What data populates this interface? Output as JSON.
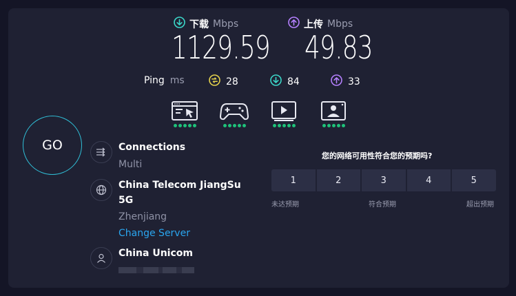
{
  "download": {
    "label": "下载",
    "unit": "Mbps",
    "value": "1129.59",
    "color": "#3bd7c9"
  },
  "upload": {
    "label": "上传",
    "unit": "Mbps",
    "value": "49.83",
    "color": "#b580ff"
  },
  "ping": {
    "label": "Ping",
    "unit": "ms",
    "idle": "28",
    "download": "84",
    "upload": "33",
    "idle_color": "#e6d34c"
  },
  "experience": {
    "dot_color": "#1ec27a",
    "items": [
      {
        "name": "web-browsing",
        "rating": 5,
        "max": 5
      },
      {
        "name": "gaming",
        "rating": 5,
        "max": 5
      },
      {
        "name": "video-streaming",
        "rating": 5,
        "max": 5
      },
      {
        "name": "video-chat",
        "rating": 5,
        "max": 5
      }
    ]
  },
  "go_label": "GO",
  "connections": {
    "title": "Connections",
    "value": "Multi"
  },
  "server": {
    "name_line1": "China Telecom JiangSu",
    "name_line2": "5G",
    "city": "Zhenjiang",
    "change_label": "Change Server"
  },
  "provider": {
    "name": "China Unicom"
  },
  "survey": {
    "question": "您的网络可用性符合您的预期吗?",
    "options": [
      "1",
      "2",
      "3",
      "4",
      "5"
    ],
    "low_label": "未达预期",
    "mid_label": "符合预期",
    "high_label": "超出预期"
  }
}
